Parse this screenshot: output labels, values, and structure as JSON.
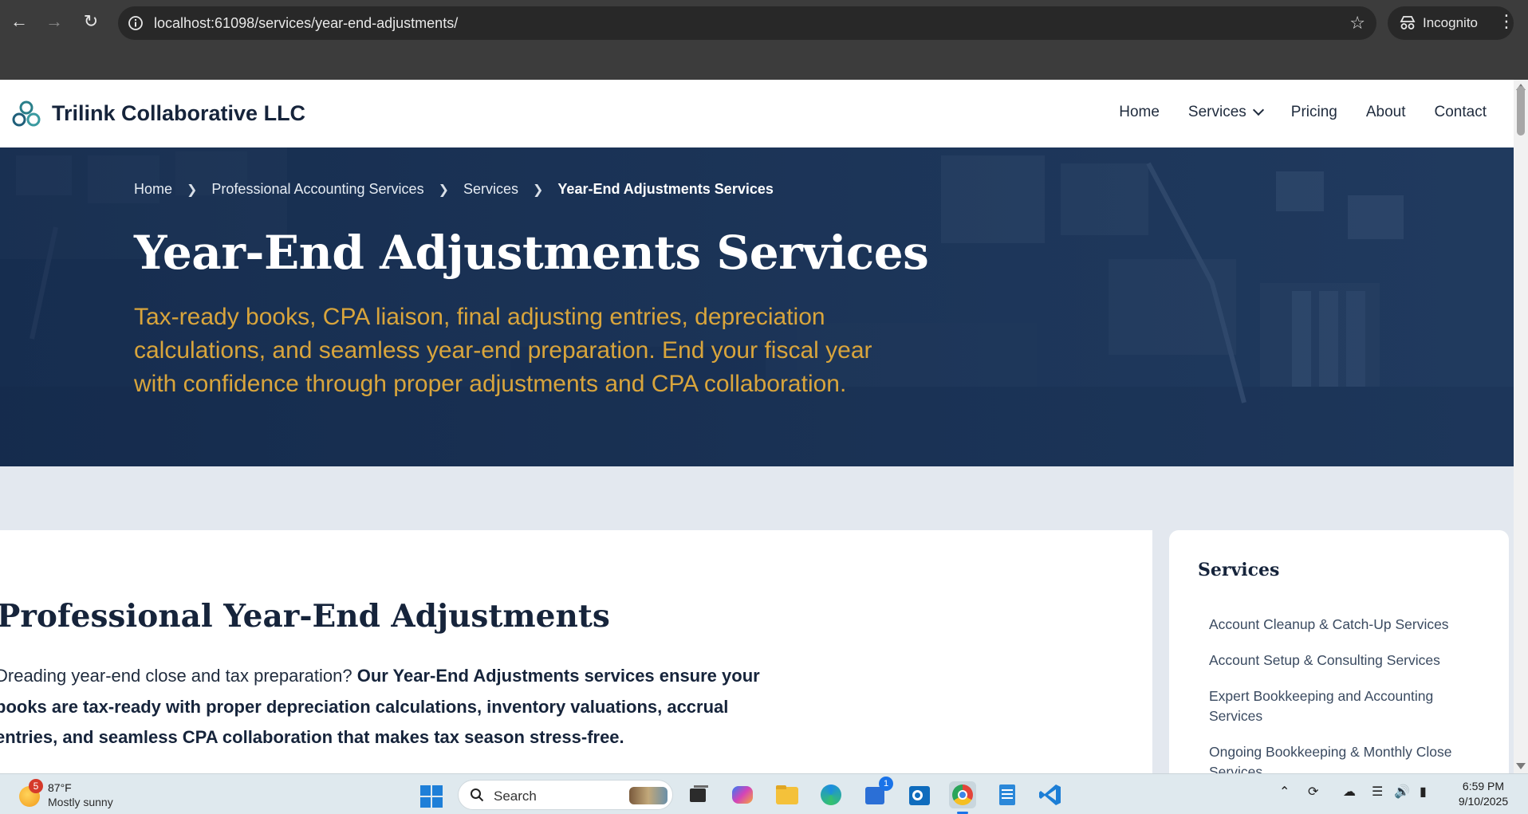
{
  "browser": {
    "url": "localhost:61098/services/year-end-adjustments/",
    "profile_label": "Incognito"
  },
  "site": {
    "brand": "Trilink Collaborative LLC",
    "nav": [
      {
        "label": "Home"
      },
      {
        "label": "Services",
        "has_dropdown": true
      },
      {
        "label": "Pricing"
      },
      {
        "label": "About"
      },
      {
        "label": "Contact"
      }
    ]
  },
  "hero": {
    "breadcrumb": [
      "Home",
      "Professional Accounting Services",
      "Services",
      "Year-End Adjustments Services"
    ],
    "title": "Year-End Adjustments Services",
    "subtitle": "Tax-ready books, CPA liaison, final adjusting entries, depreciation calculations, and seamless year-end preparation. End your fiscal year with confidence through proper adjustments and CPA collaboration."
  },
  "main": {
    "heading": "Professional Year-End Adjustments",
    "intro_plain": "Dreading year-end close and tax preparation? ",
    "intro_bold": "Our Year-End Adjustments services ensure your books are tax-ready with proper depreciation calculations, inventory valuations, accrual entries, and seamless CPA collaboration that makes tax season stress-free."
  },
  "sidebar": {
    "title": "Services",
    "items": [
      {
        "label": "Account Cleanup & Catch-Up Services"
      },
      {
        "label": "Account Setup & Consulting Services"
      },
      {
        "label": "Expert Bookkeeping and Accounting Services"
      },
      {
        "label": "Ongoing Bookkeeping & Monthly Close Services"
      }
    ]
  },
  "taskbar": {
    "weather_temp": "87°F",
    "weather_desc": "Mostly sunny",
    "weather_badge": "5",
    "search_label": "Search",
    "store_badge": "1",
    "time": "6:59 PM",
    "date": "9/10/2025"
  },
  "colors": {
    "navy": "#16243b",
    "hero_bg": "#1d3557",
    "gold": "#d9a53c",
    "page_bg": "#e3e8ef",
    "brand_teal": "#2a7f8a"
  },
  "icons": [
    "back-arrow-icon",
    "forward-arrow-icon",
    "reload-icon",
    "site-info-icon",
    "bookmark-star-icon",
    "incognito-icon",
    "menu-kebab-icon",
    "chevron-down-icon",
    "chevron-right-icon",
    "windows-start-icon",
    "search-icon"
  ]
}
